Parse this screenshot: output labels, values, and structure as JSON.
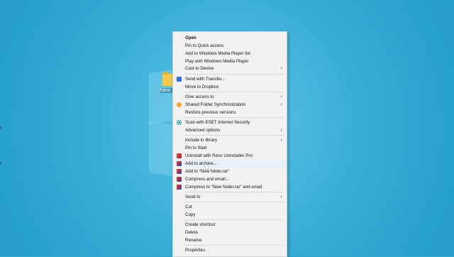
{
  "desktop": {
    "folder_label": "New"
  },
  "context_menu": {
    "items": [
      {
        "label": "Open",
        "bold": true,
        "icon": null,
        "submenu": false
      },
      {
        "label": "Pin to Quick access",
        "icon": null,
        "submenu": false
      },
      {
        "label": "Add to Windows Media Player list",
        "icon": null,
        "submenu": false
      },
      {
        "label": "Play with Windows Media Player",
        "icon": null,
        "submenu": false
      },
      {
        "label": "Cast to Device",
        "icon": null,
        "submenu": true
      },
      {
        "label": "Send with Transfer...",
        "icon": "dropbox-icon",
        "submenu": false
      },
      {
        "label": "Move to Dropbox",
        "icon": null,
        "submenu": false
      },
      {
        "label": "Give access to",
        "icon": null,
        "submenu": true
      },
      {
        "label": "Shared Folder Synchronization",
        "icon": "share-sync-icon",
        "submenu": true
      },
      {
        "label": "Restore previous versions",
        "icon": null,
        "submenu": false
      },
      {
        "label": "Scan with ESET Internet Security",
        "icon": "eset-icon",
        "submenu": false
      },
      {
        "label": "Advanced options",
        "icon": null,
        "submenu": true
      },
      {
        "label": "Include in library",
        "icon": null,
        "submenu": true
      },
      {
        "label": "Pin to Start",
        "icon": null,
        "submenu": false
      },
      {
        "label": "Uninstall with Revo Uninstaller Pro",
        "icon": "revo-icon",
        "submenu": false
      },
      {
        "label": "Add to archive...",
        "icon": "winrar-icon",
        "submenu": false,
        "hover": true
      },
      {
        "label": "Add to \"New folder.rar\"",
        "icon": "winrar-icon",
        "submenu": false
      },
      {
        "label": "Compress and email...",
        "icon": "winrar-icon",
        "submenu": false
      },
      {
        "label": "Compress to \"New folder.rar\" and email",
        "icon": "winrar-icon",
        "submenu": false
      },
      {
        "label": "Send to",
        "icon": null,
        "submenu": true
      },
      {
        "label": "Cut",
        "icon": null,
        "submenu": false
      },
      {
        "label": "Copy",
        "icon": null,
        "submenu": false
      },
      {
        "label": "Create shortcut",
        "icon": null,
        "submenu": false
      },
      {
        "label": "Delete",
        "icon": null,
        "submenu": false
      },
      {
        "label": "Rename",
        "icon": null,
        "submenu": false
      },
      {
        "label": "Properties",
        "icon": null,
        "submenu": false
      }
    ],
    "submenu_arrow": "›"
  },
  "colors": {
    "desktop_bg": "#2ea6cf",
    "menu_bg": "#f2f2f2",
    "hover_bg": "#e8f0fb"
  }
}
